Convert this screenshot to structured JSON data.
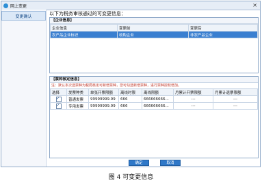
{
  "window": {
    "title": "网上变更"
  },
  "sidebar": {
    "items": [
      {
        "label": "变更确认"
      }
    ]
  },
  "main": {
    "heading": "以下为税务审核通过的可变更信息：",
    "enterprise_panel": {
      "title": "【企业信息】",
      "columns": [
        "企业信息",
        "变更前",
        "变更后"
      ],
      "rows": [
        [
          "农产品企业标识",
          "收购企业",
          "非农产品企业"
        ]
      ]
    },
    "invoice_panel": {
      "title": "【票种核定信息】",
      "note": "注：默认本次选票种为税局核定可新增票种，您可勾选新增票种，进行票种授权增加。",
      "columns": [
        "选择",
        "发票种类",
        "单张开票限额",
        "离线时限",
        "离线限额",
        "月累计开票限额",
        "月累计退票限额"
      ],
      "rows": [
        {
          "checked": true,
          "cells": [
            "普通发票",
            "99999999.99",
            "666",
            "666666666...",
            "---",
            "---"
          ]
        },
        {
          "checked": true,
          "cells": [
            "专用发票",
            "99999999.99",
            "666",
            "666666666...",
            "---",
            "---"
          ]
        }
      ]
    },
    "buttons": {
      "confirm": "确定",
      "cancel": "取消"
    }
  },
  "caption": "图 4 可变更信息",
  "colors": {
    "accent": "#2f78c8",
    "selected_row": "#3a7fd0"
  },
  "icons": {
    "app": "app-logo-icon",
    "close": "close-icon"
  }
}
